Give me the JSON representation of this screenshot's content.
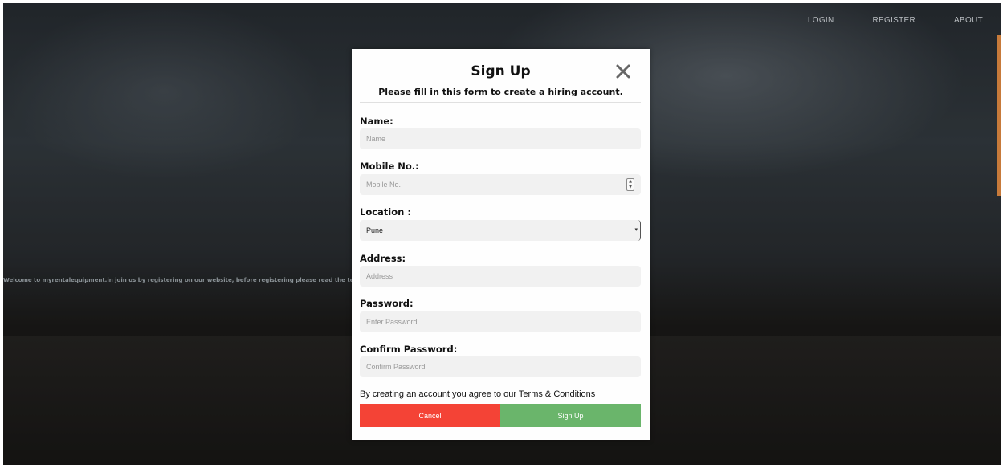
{
  "nav": {
    "login": "LOGIN",
    "register": "REGISTER",
    "about": "ABOUT"
  },
  "background": {
    "welcome_text": "Welcome to myrentalequipment.in join us by registering on our website, before registering please read the te"
  },
  "modal": {
    "title": "Sign Up",
    "subtitle": "Please fill in this form to create a hiring account.",
    "fields": {
      "name": {
        "label": "Name:",
        "placeholder": "Name"
      },
      "mobile": {
        "label": "Mobile No.:",
        "placeholder": "Mobile No."
      },
      "location": {
        "label": "Location :",
        "value": "Pune"
      },
      "address": {
        "label": "Address:",
        "placeholder": "Address"
      },
      "password": {
        "label": "Password:",
        "placeholder": "Enter Password"
      },
      "confirm_password": {
        "label": "Confirm Password:",
        "placeholder": "Confirm Password"
      }
    },
    "terms_text": "By creating an account you agree to our Terms & Conditions",
    "cancel_label": "Cancel",
    "signup_label": "Sign Up"
  },
  "colors": {
    "cancel": "#f44336",
    "signup": "#6ab56b",
    "field_bg": "#f1f1f1"
  }
}
